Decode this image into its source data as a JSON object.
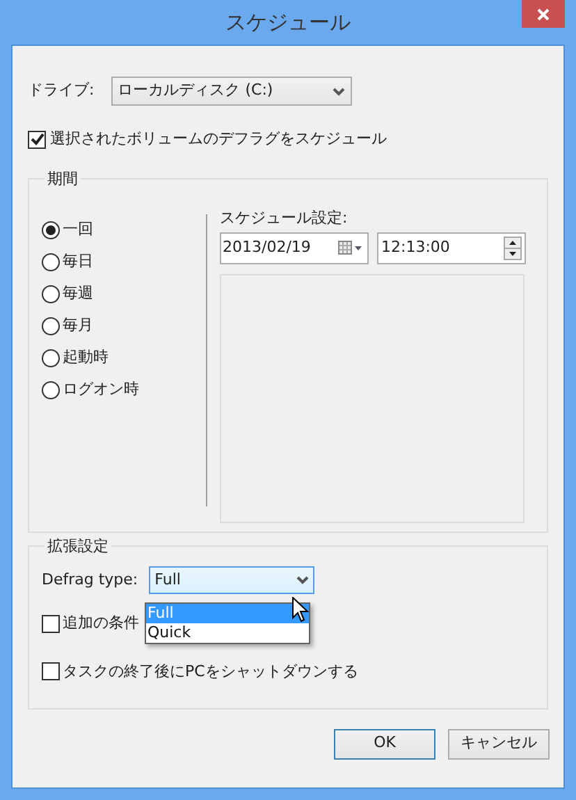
{
  "window": {
    "title": "スケジュール"
  },
  "drive": {
    "label": "ドライブ:",
    "value": "ローカルディスク (C:)"
  },
  "schedule_checkbox": {
    "label": "選択されたボリュームのデフラグをスケジュール",
    "checked": true
  },
  "period_group": {
    "title": "期間",
    "options": [
      {
        "label": "一回",
        "selected": true
      },
      {
        "label": "毎日",
        "selected": false
      },
      {
        "label": "毎週",
        "selected": false
      },
      {
        "label": "毎月",
        "selected": false
      },
      {
        "label": "起動時",
        "selected": false
      },
      {
        "label": "ログオン時",
        "selected": false
      }
    ]
  },
  "schedule_settings": {
    "label": "スケジュール設定:",
    "date": "2013/02/19",
    "time": "12:13:00"
  },
  "advanced_group": {
    "title": "拡張設定",
    "defrag_type": {
      "label": "Defrag type:",
      "value": "Full",
      "expanded": true,
      "options": [
        {
          "label": "Full",
          "selected": true
        },
        {
          "label": "Quick",
          "selected": false
        }
      ]
    },
    "checkboxes": [
      {
        "label": "追加の条件",
        "checked": false
      },
      {
        "label": "タスクの終了後にPCをシャットダウンする",
        "checked": false
      }
    ]
  },
  "buttons": [
    {
      "label": "OK",
      "kind": "default"
    },
    {
      "label": "キャンセル",
      "kind": "normal"
    }
  ]
}
